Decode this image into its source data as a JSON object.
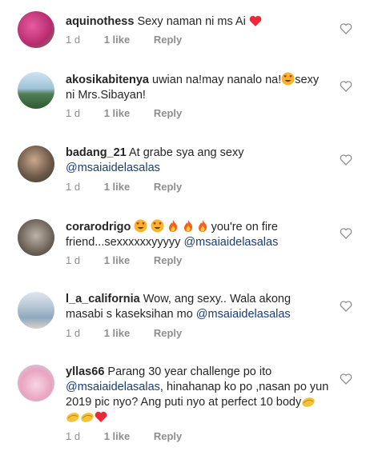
{
  "comments": [
    {
      "username": "aquinothess",
      "text": "Sexy naman ni ms Ai",
      "emoji_after": [
        "red-heart"
      ],
      "time": "1 d",
      "likes": "1 like",
      "reply": "Reply"
    },
    {
      "username": "akosikabitenya",
      "text": "uwian na!may nanalo na!",
      "text2": "sexy ni Mrs.Sibayan!",
      "emoji_mid": [
        "heart-eyes"
      ],
      "time": "1 d",
      "likes": "1 like",
      "reply": "Reply"
    },
    {
      "username": "badang_21",
      "text": "At grabe sya ang sexy",
      "mention": "@msaiaidelasalas",
      "time": "1 d",
      "likes": "1 like",
      "reply": "Reply"
    },
    {
      "username": "corarodrigo",
      "emoji_before": [
        "heart-eyes",
        "heart-eyes",
        "fire",
        "fire",
        "fire"
      ],
      "text": "you're on fire friend...sexxxxxxyyyyy",
      "mention": "@msaiaidelasalas",
      "time": "1 d",
      "likes": "1 like",
      "reply": "Reply"
    },
    {
      "username": "l_a_california",
      "text": "Wow, ang sexy.. Wala akong masabi s kaseksihan mo",
      "mention": "@msaiaidelasalas",
      "time": "1 d",
      "likes": "1 like",
      "reply": "Reply"
    },
    {
      "username": "yllas66",
      "text": "Parang 30 year challenge po ito",
      "mention": "@msaiaidelasalas",
      "text2": ", hinahanap ko po ,nasan po yun 2019 pic nyo? Ang puti nyo at perfect 10 body",
      "emoji_after": [
        "clapping",
        "clapping",
        "clapping",
        "red-heart"
      ],
      "time": "1 d",
      "likes": "1 like",
      "reply": "Reply"
    }
  ],
  "colors": {
    "meta_gray": "#8e8e8e",
    "mention_blue": "#1a3d6d",
    "heart_red": "#ed2939",
    "heart_outline": "#8e8e8e"
  }
}
